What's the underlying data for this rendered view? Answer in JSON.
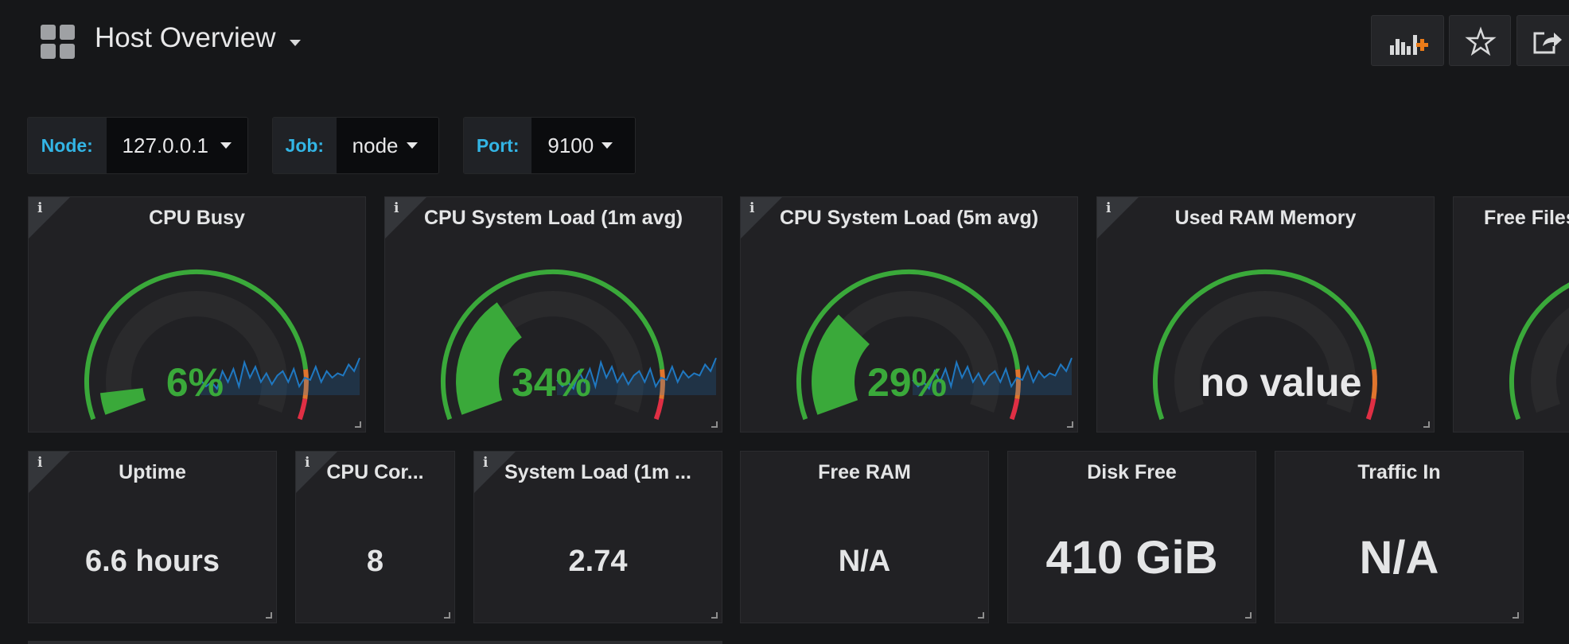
{
  "header": {
    "title": "Host Overview",
    "buttons": [
      {
        "name": "add-panel-icon"
      },
      {
        "name": "star-icon"
      },
      {
        "name": "share-icon"
      }
    ]
  },
  "variables": {
    "node": {
      "label": "Node:",
      "value": "127.0.0.1"
    },
    "job": {
      "label": "Job:",
      "value": "node"
    },
    "port": {
      "label": "Port:",
      "value": "9100"
    }
  },
  "colors": {
    "ok": "#3aa93a",
    "warn": "#e0752d",
    "crit": "#e02f44",
    "label": "#33b5e5",
    "sparkline": "#1f78c1"
  },
  "gauges": [
    {
      "title": "CPU Busy",
      "value": "6%",
      "fraction": 0.06,
      "sparkline": true
    },
    {
      "title": "CPU System Load (1m avg)",
      "value": "34%",
      "fraction": 0.34,
      "sparkline": true
    },
    {
      "title": "CPU System Load (5m avg)",
      "value": "29%",
      "fraction": 0.29,
      "sparkline": true
    },
    {
      "title": "Used RAM Memory",
      "value": "no value",
      "fraction": 0,
      "sparkline": false
    },
    {
      "title": "Free Files",
      "value": "",
      "fraction": 0,
      "sparkline": false
    }
  ],
  "stats": [
    {
      "title": "Uptime",
      "value": "6.6 hours"
    },
    {
      "title": "CPU Cor...",
      "value": "8"
    },
    {
      "title": "System Load (1m ...",
      "value": "2.74"
    },
    {
      "title": "Free RAM",
      "value": "N/A"
    },
    {
      "title": "Disk Free",
      "value": "410 GiB"
    },
    {
      "title": "Traffic In",
      "value": "N/A"
    }
  ]
}
